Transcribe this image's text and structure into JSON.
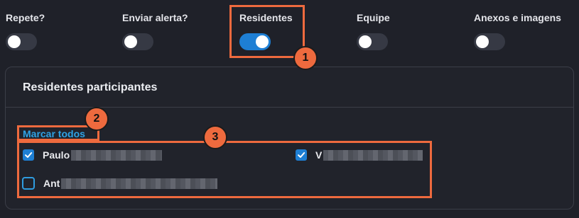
{
  "toggles": [
    {
      "label": "Repete?",
      "on": false
    },
    {
      "label": "Enviar alerta?",
      "on": false
    },
    {
      "label": "Residentes",
      "on": true
    },
    {
      "label": "Equipe",
      "on": false
    },
    {
      "label": "Anexos e imagens",
      "on": false
    }
  ],
  "card": {
    "title": "Residentes participantes",
    "select_all_label": "Marcar todos"
  },
  "residents": [
    {
      "name_visible": "Paulo",
      "checked": true
    },
    {
      "name_visible": "V",
      "checked": true
    },
    {
      "name_visible": "Ant",
      "checked": false
    }
  ],
  "annotations": {
    "markers": [
      "1",
      "2",
      "3"
    ]
  },
  "colors": {
    "background": "#1f2129",
    "accent": "#1e7fd4",
    "link": "#2fa3e6",
    "annotation": "#ee6a3e"
  }
}
